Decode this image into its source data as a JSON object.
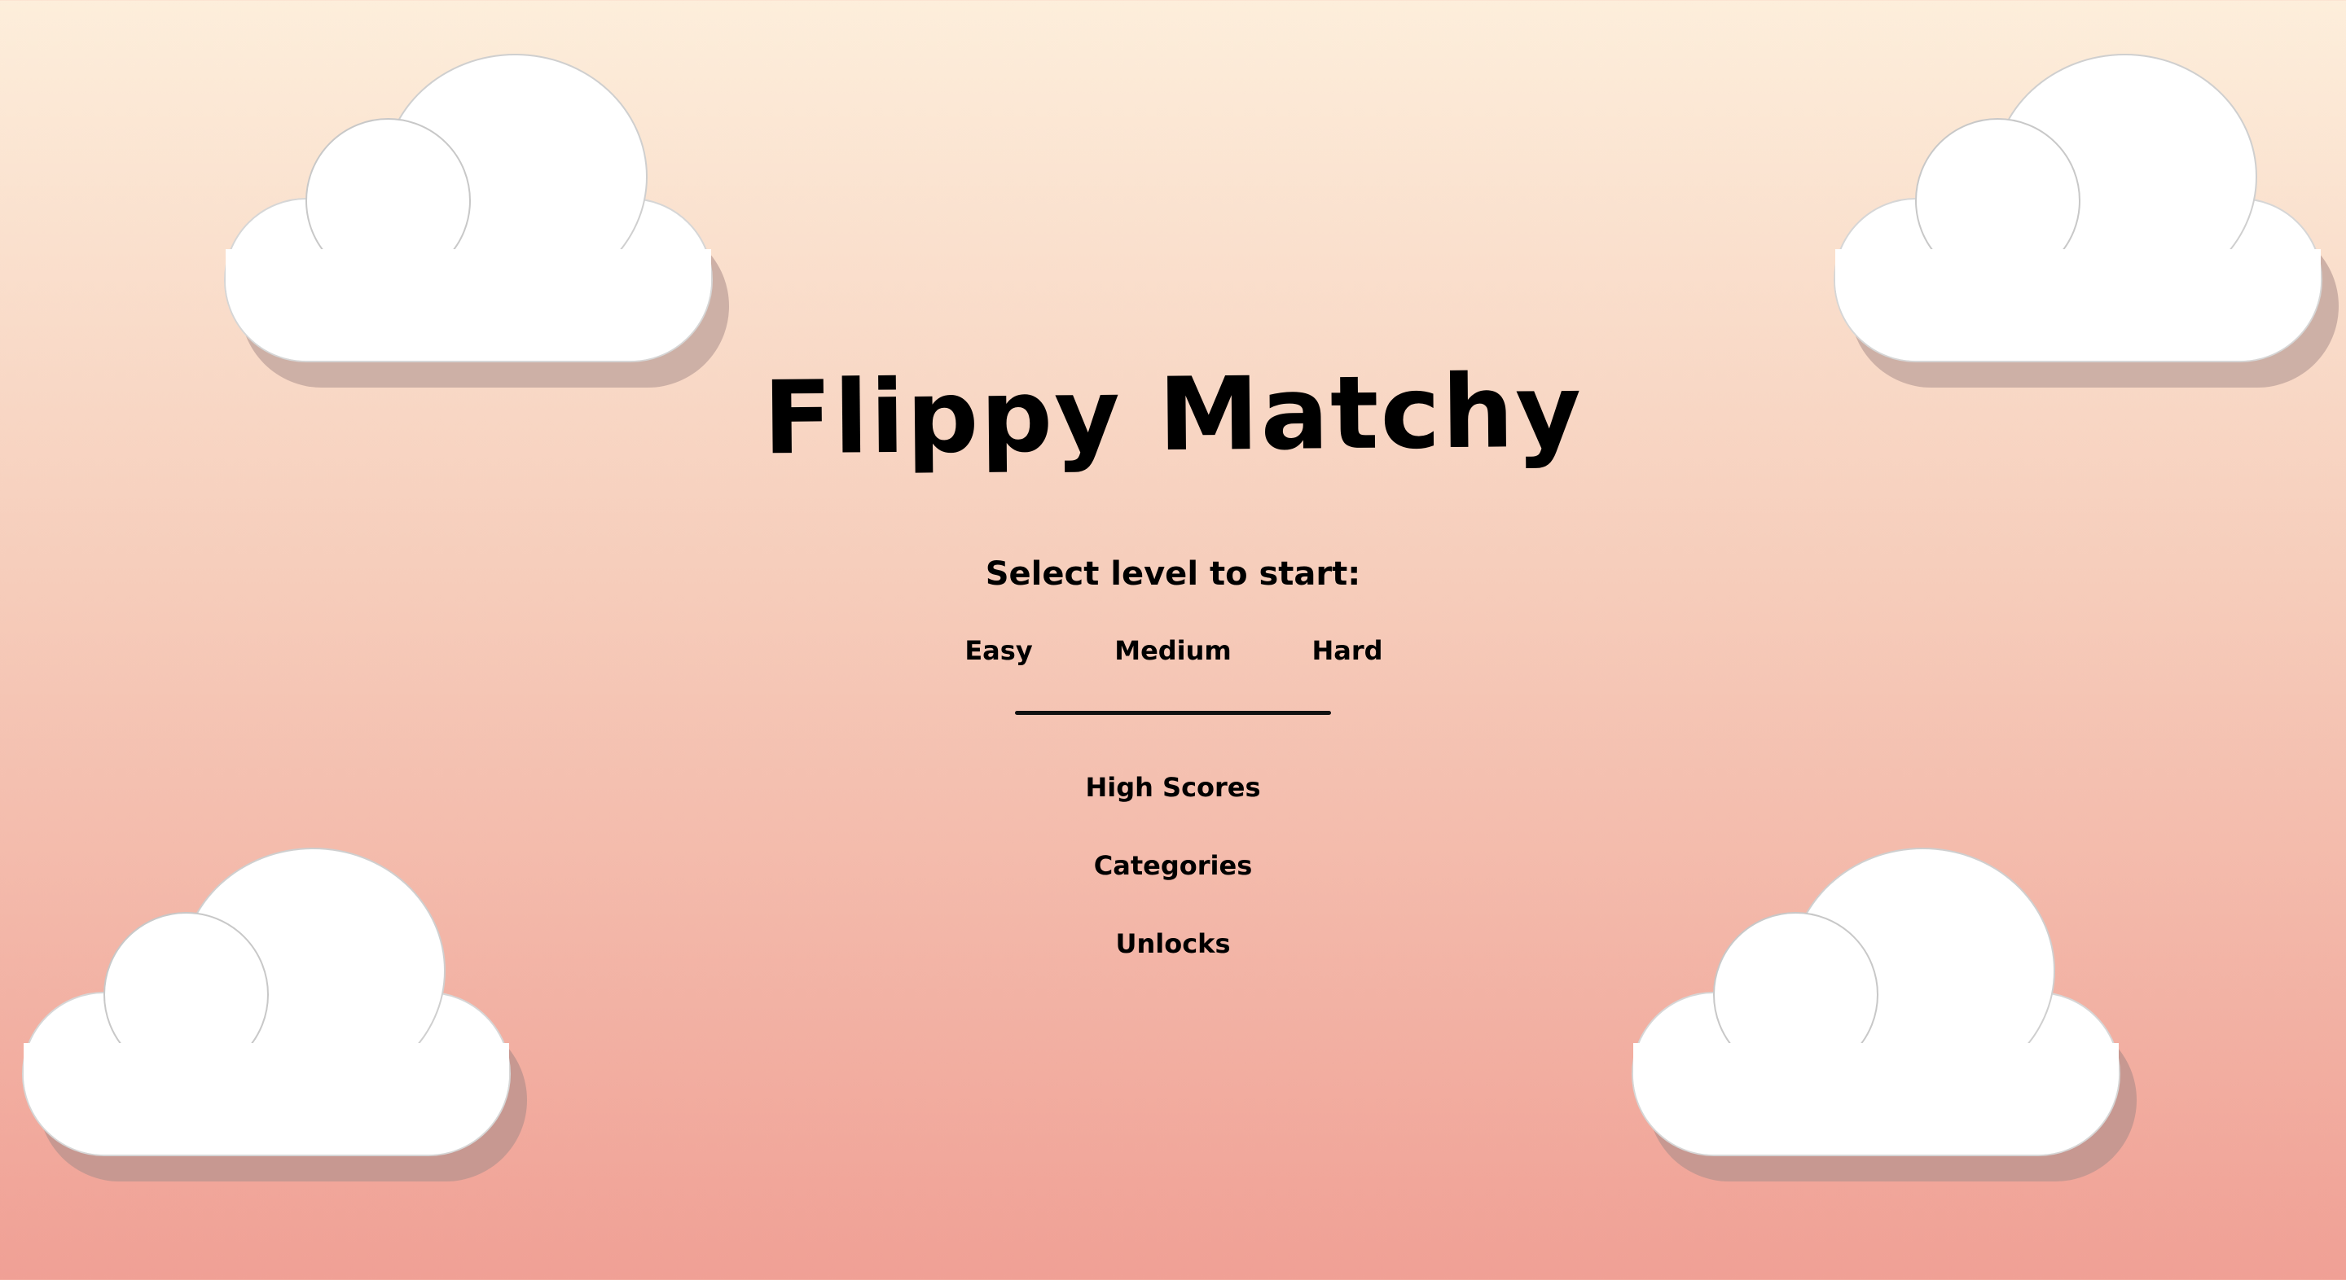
{
  "game": {
    "title": "Flippy Matchy"
  },
  "level_select": {
    "prompt": "Select level to start:",
    "levels": [
      {
        "label": "Easy"
      },
      {
        "label": "Medium"
      },
      {
        "label": "Hard"
      }
    ]
  },
  "menu": {
    "high_scores": "High Scores",
    "categories": "Categories",
    "unlocks": "Unlocks"
  },
  "colors": {
    "background_top": "#fdeedb",
    "background_bottom": "#f0a095",
    "cloud": "#ffffff",
    "text": "#000000"
  }
}
